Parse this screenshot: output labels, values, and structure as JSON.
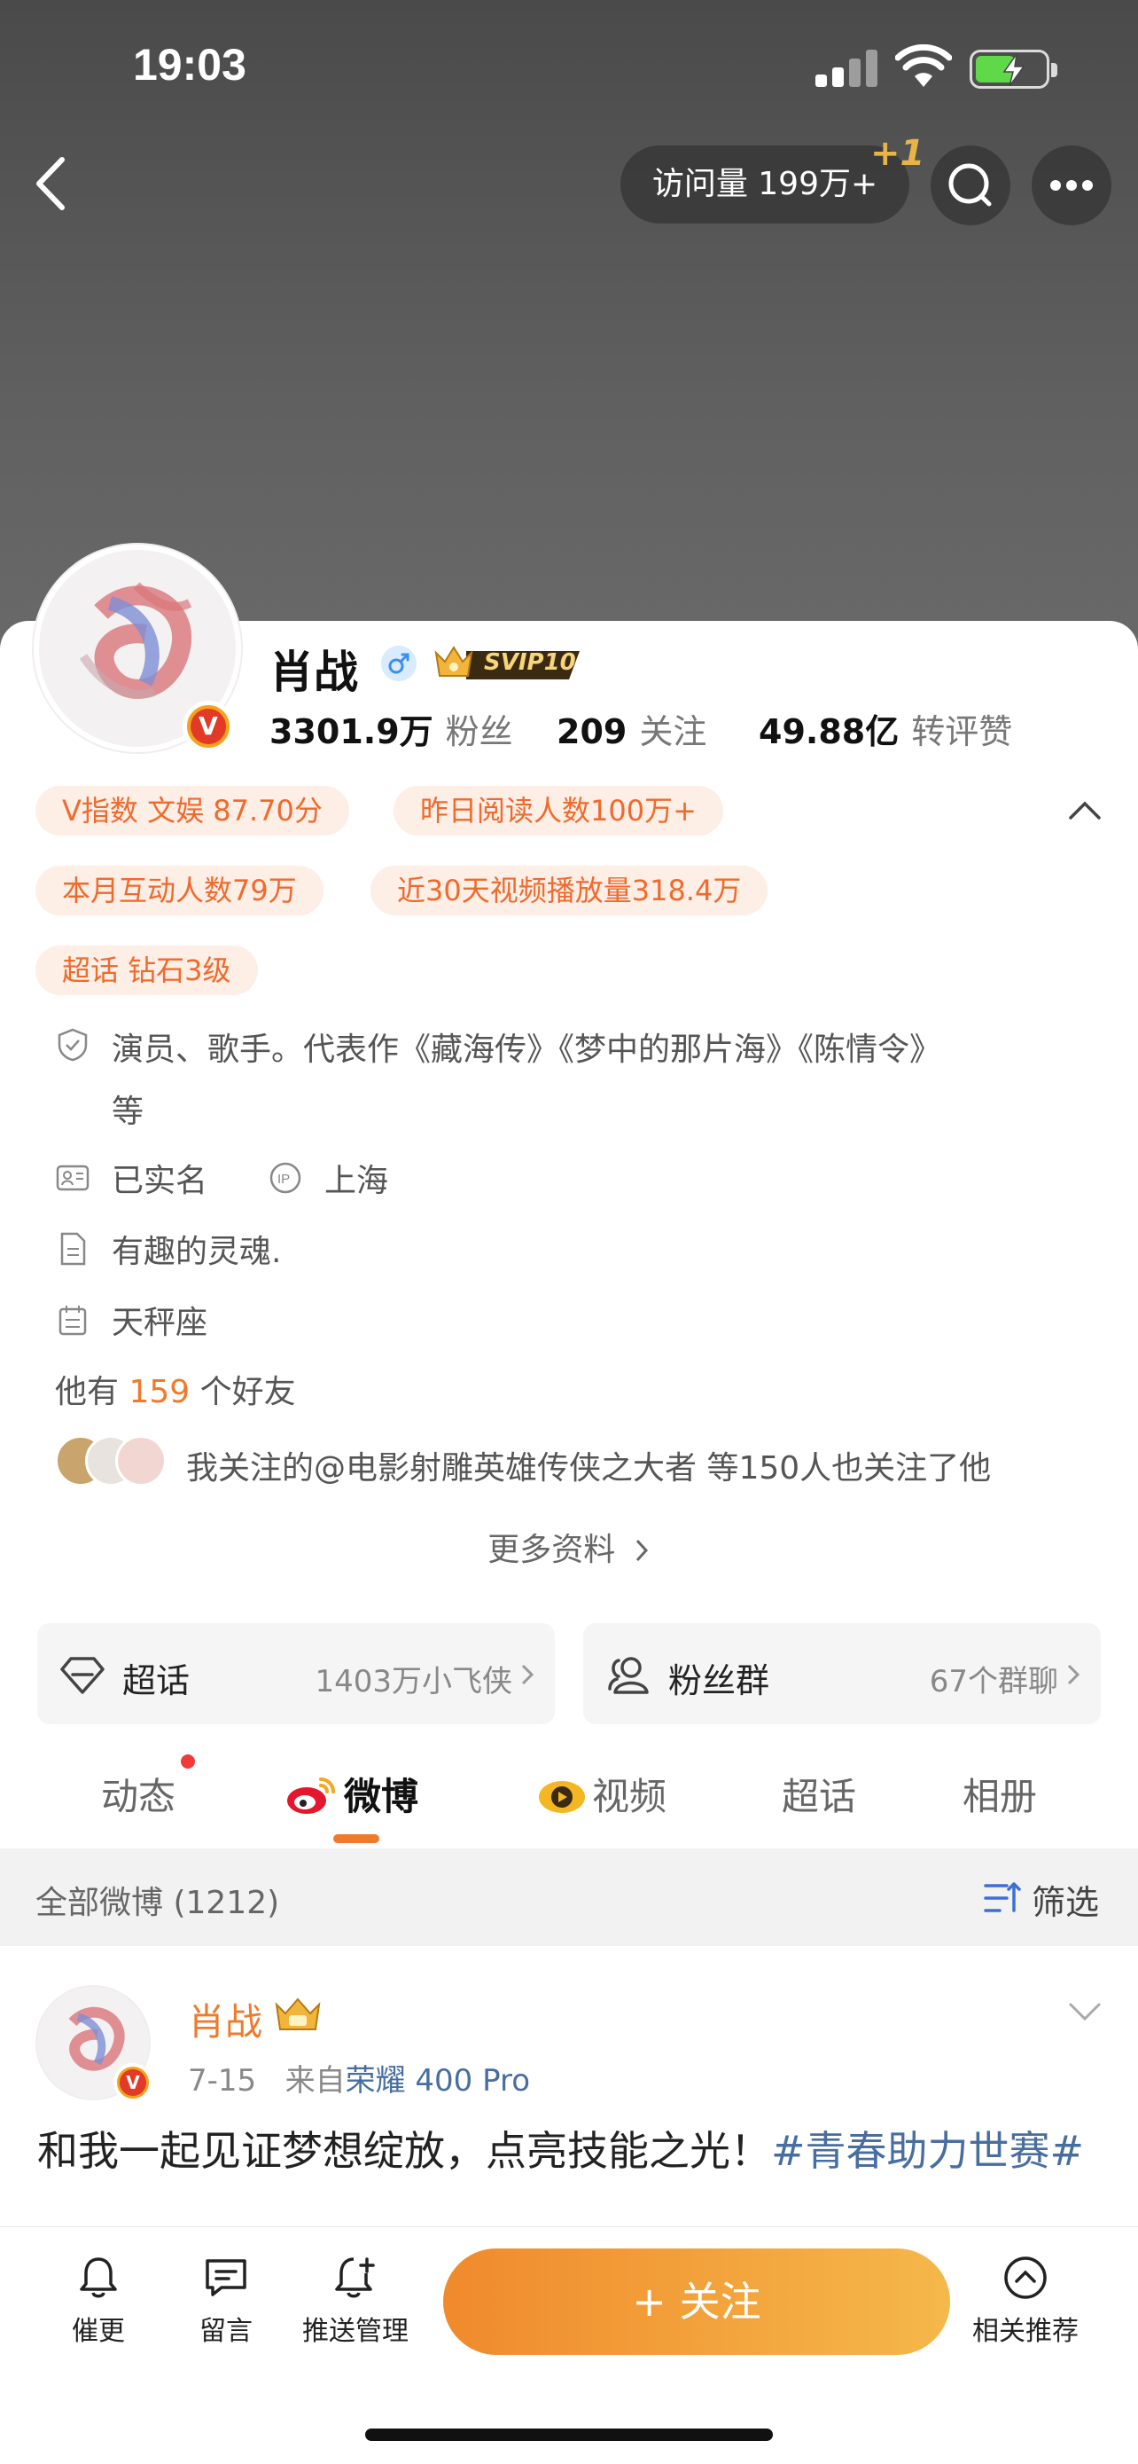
{
  "status": {
    "time": "19:03"
  },
  "header": {
    "visits_label": "访问量 199万+",
    "visits_plus": "+1"
  },
  "profile": {
    "name": "肖战",
    "svip": "SVIP10",
    "stats": [
      {
        "value": "3301.9万",
        "label": "粉丝"
      },
      {
        "value": "209",
        "label": "关注"
      },
      {
        "value": "49.88亿",
        "label": "转评赞"
      }
    ]
  },
  "tags": [
    "V指数 文娱 87.70分",
    "昨日阅读人数100万+",
    "本月互动人数79万",
    "近30天视频播放量318.4万",
    "超话 钻石3级"
  ],
  "info": {
    "bio_line1": "演员、歌手。代表作《藏海传》《梦中的那片海》《陈情令》",
    "bio_line2": "等",
    "verified": "已实名",
    "location": "上海",
    "signature": "有趣的灵魂.",
    "zodiac": "天秤座",
    "friends_prefix": "他有",
    "friends_count": "159",
    "friends_suffix": "个好友",
    "mutual_text": "我关注的@电影射雕英雄传侠之大者 等150人也关注了他",
    "more_info": "更多资料"
  },
  "features": [
    {
      "label": "超话",
      "value": "1403万小飞侠"
    },
    {
      "label": "粉丝群",
      "value": "67个群聊"
    }
  ],
  "tabs": [
    "动态",
    "微博",
    "视频",
    "超话",
    "相册"
  ],
  "filter": {
    "title": "全部微博 (1212)",
    "button": "筛选"
  },
  "post": {
    "author": "肖战",
    "date": "7-15",
    "from_prefix": "来自",
    "device": "荣耀 400 Pro",
    "text": "和我一起见证梦想绽放，点亮技能之光！",
    "topic": "#青春助力世赛#"
  },
  "bottom_bar": {
    "remind": "催更",
    "message": "留言",
    "push": "推送管理",
    "follow": "+ 关注",
    "related": "相关推荐"
  },
  "colors": {
    "accent": "#ef7a2c",
    "link": "#486ea0"
  }
}
